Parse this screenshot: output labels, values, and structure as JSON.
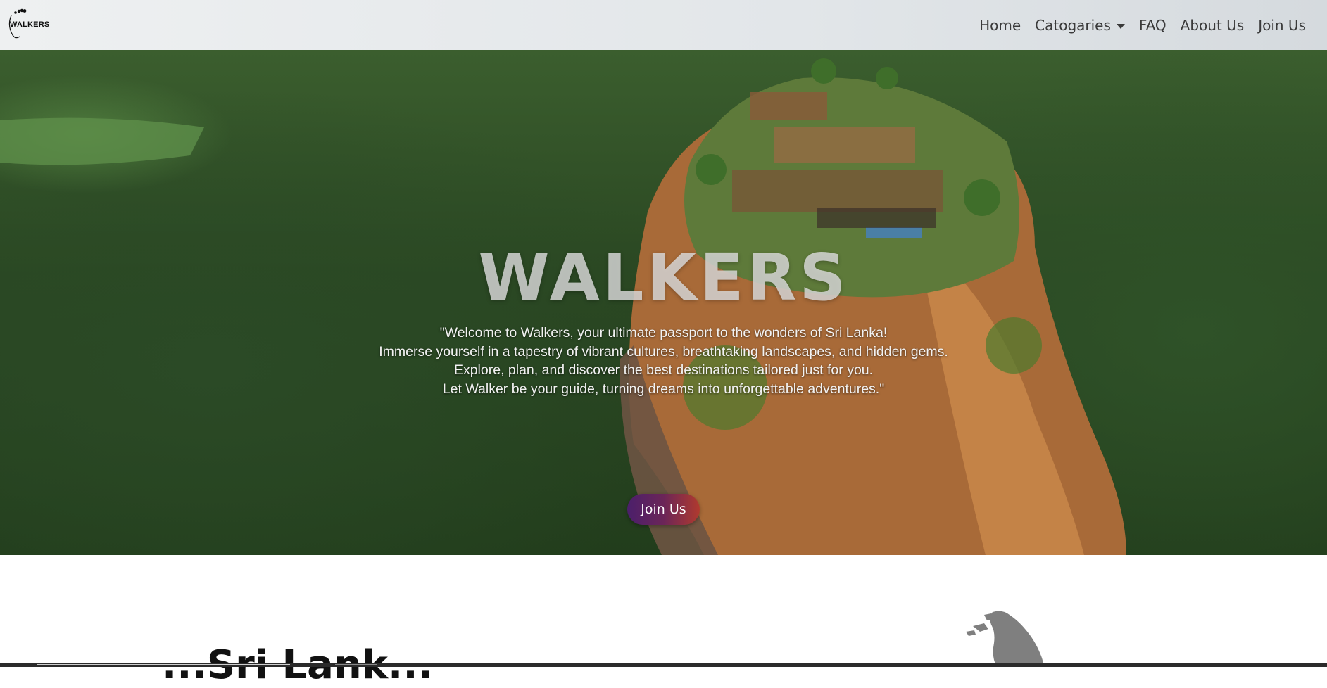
{
  "navbar": {
    "logo_text": "WALKERS",
    "links": {
      "home": "Home",
      "categories": "Catogaries",
      "faq": "FAQ",
      "about": "About Us",
      "join": "Join Us"
    }
  },
  "hero": {
    "title": "WALKERS",
    "lines": [
      "\"Welcome to Walkers, your ultimate passport to the wonders of Sri Lanka!",
      "Immerse yourself in a tapestry of vibrant cultures, breathtaking landscapes, and hidden gems.",
      "Explore, plan, and discover the best destinations tailored just for you.",
      "Let Walker be your guide, turning dreams into unforgettable adventures.\""
    ],
    "button_label": "Join Us"
  },
  "section": {
    "heading": "...Sri Lank..."
  },
  "icons": {
    "logo": "footprints-logo-icon",
    "categories_caret": "caret-down-icon",
    "map": "sri-lanka-map-icon"
  },
  "colors": {
    "button_gradient_start": "#4b1f6b",
    "button_gradient_end": "#b03a2e",
    "nav_text": "#3a3a3a"
  }
}
